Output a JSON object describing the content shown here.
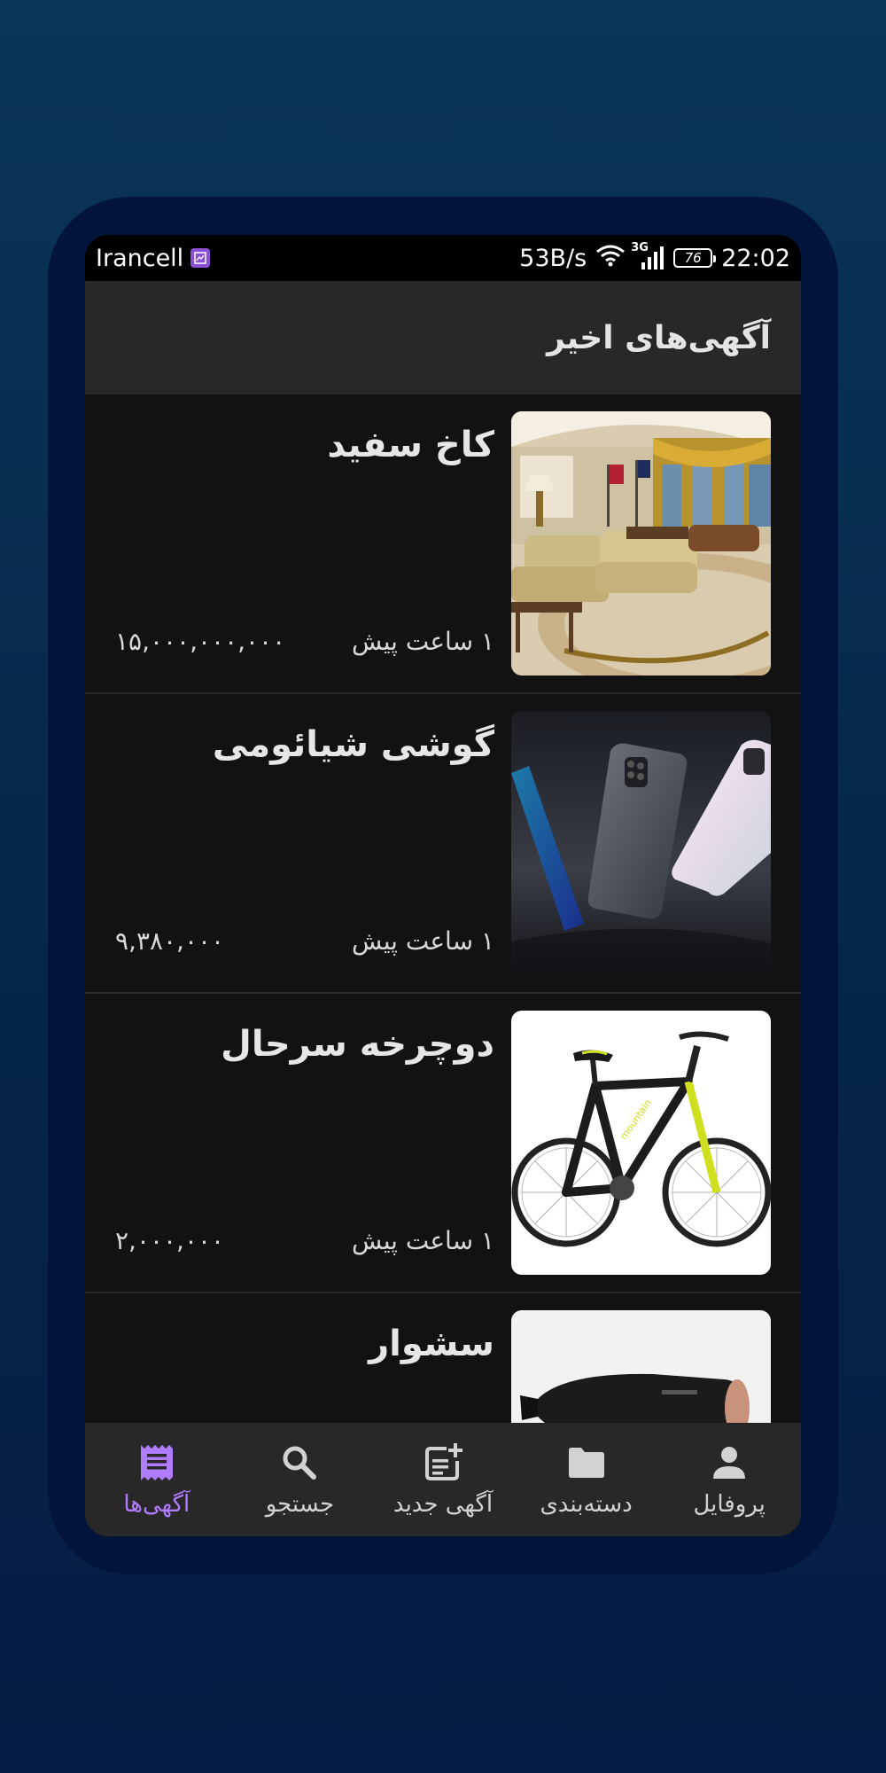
{
  "status_bar": {
    "carrier": "Irancell",
    "net_speed": "53B/s",
    "network_type": "3G",
    "battery": "76",
    "time": "22:02"
  },
  "header": {
    "title": "آگهی‌های اخیر"
  },
  "ads": [
    {
      "title": "کاخ سفید",
      "time": "۱ ساعت پیش",
      "price": "۱۵,۰۰۰,۰۰۰,۰۰۰",
      "image_icon": "room-photo"
    },
    {
      "title": "گوشی شیائومی",
      "time": "۱ ساعت پیش",
      "price": "۹,۳۸۰,۰۰۰",
      "image_icon": "phone-photo"
    },
    {
      "title": "دوچرخه سرحال",
      "time": "۱ ساعت پیش",
      "price": "۲,۰۰۰,۰۰۰",
      "image_icon": "bicycle-photo"
    },
    {
      "title": "سشوار",
      "time": "",
      "price": "",
      "image_icon": "hair-dryer-photo"
    }
  ],
  "bottom_nav": {
    "items": [
      {
        "label": "آگهی‌ها",
        "icon": "receipt-icon",
        "active": true
      },
      {
        "label": "جستجو",
        "icon": "search-icon",
        "active": false
      },
      {
        "label": "آگهی جدید",
        "icon": "post-add-icon",
        "active": false
      },
      {
        "label": "دسته‌بندی",
        "icon": "folder-icon",
        "active": false
      },
      {
        "label": "پروفایل",
        "icon": "person-icon",
        "active": false
      }
    ]
  },
  "colors": {
    "accent": "#b07cff",
    "background": "#121212",
    "bar": "#282828"
  }
}
